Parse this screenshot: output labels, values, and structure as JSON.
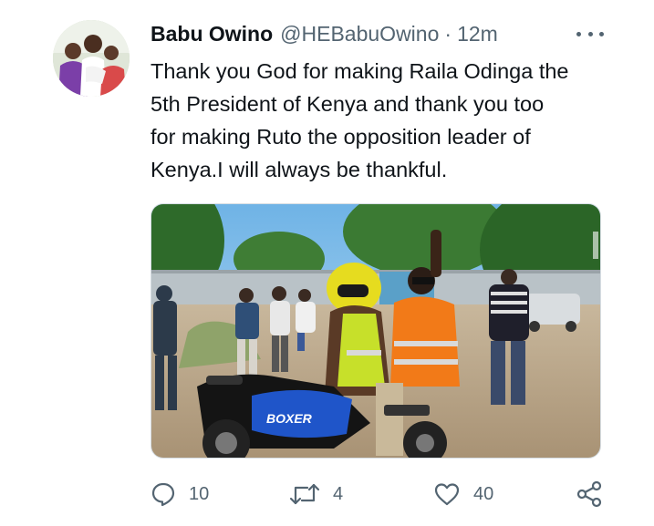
{
  "tweet": {
    "display_name": "Babu Owino",
    "handle": "@HEBabuOwino",
    "separator": "·",
    "time": "12m",
    "text_lines": [
      "Thank you God for making Raila Odinga the",
      "5th President of Kenya and thank you too",
      "for making Ruto the opposition leader of",
      "Kenya.I will always be thankful."
    ],
    "photo": {
      "bike_brand": "BOXER"
    }
  },
  "actions": {
    "reply": {
      "icon": "reply-icon",
      "count": "10"
    },
    "retweet": {
      "icon": "retweet-icon",
      "count": "4"
    },
    "like": {
      "icon": "heart-icon",
      "count": "40"
    },
    "share": {
      "icon": "share-icon"
    }
  },
  "colors": {
    "text": "#0f1419",
    "secondary": "#536471",
    "background": "#ffffff"
  }
}
